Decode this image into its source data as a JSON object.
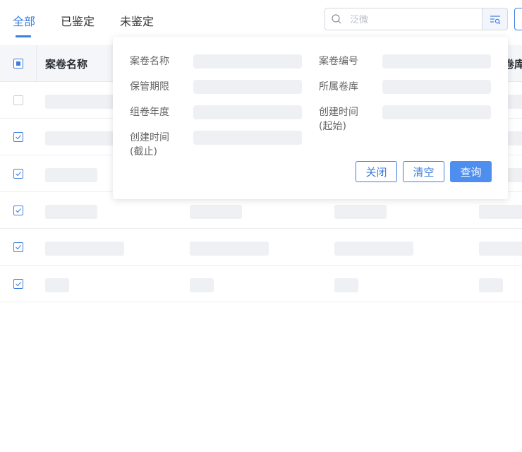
{
  "tabs": [
    {
      "label": "全部",
      "active": true
    },
    {
      "label": "已鉴定",
      "active": false
    },
    {
      "label": "未鉴定",
      "active": false
    }
  ],
  "search": {
    "placeholder": "泛微",
    "value": ""
  },
  "colors": {
    "accent": "#3d7fe0",
    "primary_button": "#4d8eef",
    "skeleton": "#eef0f3"
  },
  "table": {
    "headers": [
      "案卷名称",
      "卷库"
    ],
    "rows": [
      {
        "checked": false
      },
      {
        "checked": true
      },
      {
        "checked": true
      },
      {
        "checked": true
      },
      {
        "checked": true
      },
      {
        "checked": true
      }
    ]
  },
  "filter_panel": {
    "fields": [
      {
        "label": "案卷名称"
      },
      {
        "label": "案卷编号"
      },
      {
        "label": "保管期限"
      },
      {
        "label": "所属卷库"
      },
      {
        "label": "组卷年度"
      },
      {
        "label": "创建时间(起始)",
        "line1": "创建时间",
        "line2": "(起始)"
      },
      {
        "label": "创建时间(截止)",
        "line1": "创建时间",
        "line2": "(截止)"
      }
    ],
    "buttons": {
      "close": "关闭",
      "clear": "清空",
      "query": "查询"
    }
  }
}
